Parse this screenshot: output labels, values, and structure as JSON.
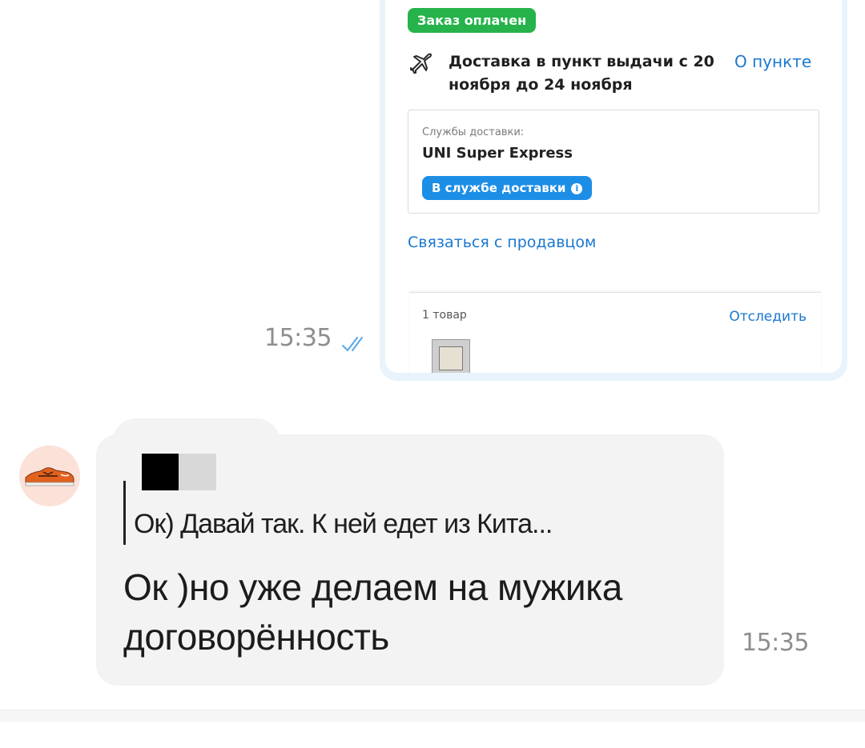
{
  "outgoing_message": {
    "screenshot": {
      "paid_badge": "Заказ оплачен",
      "delivery_text": "Доставка в пункт выдачи с 20 ноября до 24 ноября",
      "about_link": "О пункте",
      "services_label": "Службы доставки:",
      "services_value": "UNI Super Express",
      "status_pill": "В службе доставки",
      "contact_link": "Связаться с продавцом",
      "goods_count": "1 товар",
      "track_link": "Отследить"
    },
    "time": "15:35",
    "read_status": "read",
    "colors": {
      "badge_green": "#27b34b",
      "link_blue": "#1a78d0",
      "pill_blue": "#1d8ee6",
      "read_ticks": "#5aa8e6"
    }
  },
  "incoming_message": {
    "sender_name": "█",
    "quoted_text": "Ок) Давай так. К ней едет из Кита...",
    "text": "Ок )но уже делаем на мужика договорённость",
    "time": "15:35",
    "avatar_icon": "sneaker-avatar-icon"
  }
}
